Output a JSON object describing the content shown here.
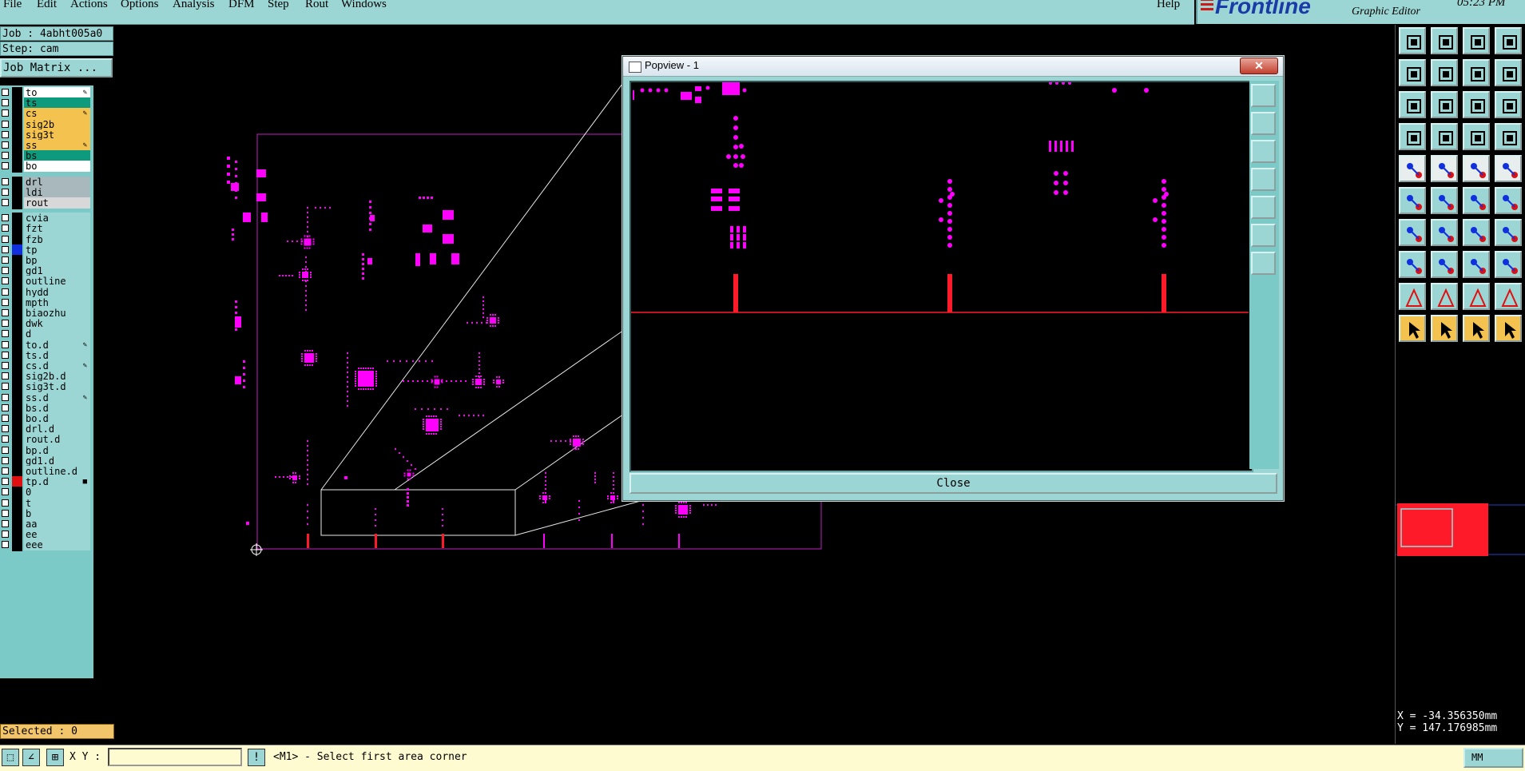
{
  "menu": {
    "items": [
      "File",
      "Edit",
      "Actions",
      "Options",
      "Analysis",
      "DFM",
      "Step",
      "Rout",
      "Windows"
    ],
    "help": "Help"
  },
  "brand": {
    "logo": "Frontline",
    "subtitle": "Graphic Editor",
    "time": "05:23 PM"
  },
  "job": {
    "job_line": "Job : 4abht005a0",
    "step_line": "Step: cam",
    "matrix_button": "Job Matrix ..."
  },
  "layers": [
    {
      "name": "to",
      "color": "#000000",
      "bg": "#ffffff",
      "mark": "pencil"
    },
    {
      "name": "ts",
      "color": "#000000",
      "bg": "#0e9a7c",
      "mark": ""
    },
    {
      "name": "cs",
      "color": "#000000",
      "bg": "#f3c24f",
      "mark": "pencil"
    },
    {
      "name": "sig2b",
      "color": "#000000",
      "bg": "#f3c24f",
      "mark": ""
    },
    {
      "name": "sig3t",
      "color": "#000000",
      "bg": "#f3c24f",
      "mark": ""
    },
    {
      "name": "ss",
      "color": "#000000",
      "bg": "#f3c24f",
      "mark": "pencil"
    },
    {
      "name": "bs",
      "color": "#000000",
      "bg": "#0e9a7c",
      "mark": ""
    },
    {
      "name": "bo",
      "color": "#000000",
      "bg": "#ffffff",
      "mark": ""
    },
    {
      "name": "drl",
      "color": "#000000",
      "bg": "#a8b8bc",
      "mark": ""
    },
    {
      "name": "ldi",
      "color": "#000000",
      "bg": "#a8b8bc",
      "mark": ""
    },
    {
      "name": "rout",
      "color": "#000000",
      "bg": "#d8d8d8",
      "mark": ""
    },
    {
      "name": "cvia",
      "color": "#000000",
      "bg": "#9cd6d4",
      "mark": ""
    },
    {
      "name": "fzt",
      "color": "#000000",
      "bg": "#9cd6d4",
      "mark": ""
    },
    {
      "name": "fzb",
      "color": "#000000",
      "bg": "#9cd6d4",
      "mark": ""
    },
    {
      "name": "tp",
      "color": "#1030e0",
      "bg": "#9cd6d4",
      "mark": ""
    },
    {
      "name": "bp",
      "color": "#000000",
      "bg": "#9cd6d4",
      "mark": ""
    },
    {
      "name": "gd1",
      "color": "#000000",
      "bg": "#9cd6d4",
      "mark": ""
    },
    {
      "name": "outline",
      "color": "#000000",
      "bg": "#9cd6d4",
      "mark": ""
    },
    {
      "name": "hydd",
      "color": "#000000",
      "bg": "#9cd6d4",
      "mark": ""
    },
    {
      "name": "mpth",
      "color": "#000000",
      "bg": "#9cd6d4",
      "mark": ""
    },
    {
      "name": "biaozhu",
      "color": "#000000",
      "bg": "#9cd6d4",
      "mark": ""
    },
    {
      "name": "dwk",
      "color": "#000000",
      "bg": "#9cd6d4",
      "mark": ""
    },
    {
      "name": "d",
      "color": "#000000",
      "bg": "#9cd6d4",
      "mark": ""
    },
    {
      "name": "to.d",
      "color": "#000000",
      "bg": "#9cd6d4",
      "mark": "pencil"
    },
    {
      "name": "ts.d",
      "color": "#000000",
      "bg": "#9cd6d4",
      "mark": ""
    },
    {
      "name": "cs.d",
      "color": "#000000",
      "bg": "#9cd6d4",
      "mark": "pencil"
    },
    {
      "name": "sig2b.d",
      "color": "#000000",
      "bg": "#9cd6d4",
      "mark": ""
    },
    {
      "name": "sig3t.d",
      "color": "#000000",
      "bg": "#9cd6d4",
      "mark": ""
    },
    {
      "name": "ss.d",
      "color": "#000000",
      "bg": "#9cd6d4",
      "mark": "pencil"
    },
    {
      "name": "bs.d",
      "color": "#000000",
      "bg": "#9cd6d4",
      "mark": ""
    },
    {
      "name": "bo.d",
      "color": "#000000",
      "bg": "#9cd6d4",
      "mark": ""
    },
    {
      "name": "drl.d",
      "color": "#000000",
      "bg": "#9cd6d4",
      "mark": ""
    },
    {
      "name": "rout.d",
      "color": "#000000",
      "bg": "#9cd6d4",
      "mark": ""
    },
    {
      "name": "bp.d",
      "color": "#000000",
      "bg": "#9cd6d4",
      "mark": ""
    },
    {
      "name": "gd1.d",
      "color": "#000000",
      "bg": "#9cd6d4",
      "mark": ""
    },
    {
      "name": "outline.d",
      "color": "#000000",
      "bg": "#9cd6d4",
      "mark": ""
    },
    {
      "name": "tp.d",
      "color": "#e01010",
      "bg": "#9cd6d4",
      "mark": "square"
    },
    {
      "name": "0",
      "color": "#000000",
      "bg": "#9cd6d4",
      "mark": ""
    },
    {
      "name": "t",
      "color": "#000000",
      "bg": "#9cd6d4",
      "mark": ""
    },
    {
      "name": "b",
      "color": "#000000",
      "bg": "#9cd6d4",
      "mark": ""
    },
    {
      "name": "aa",
      "color": "#000000",
      "bg": "#9cd6d4",
      "mark": ""
    },
    {
      "name": "ee",
      "color": "#000000",
      "bg": "#9cd6d4",
      "mark": ""
    },
    {
      "name": "eee",
      "color": "#000000",
      "bg": "#9cd6d4",
      "mark": ""
    }
  ],
  "status": {
    "selected": "Selected : 0",
    "xy_label": "X Y :",
    "xy_value": "",
    "prompt": "<M1> - Select first area corner",
    "units": "MM"
  },
  "coords": {
    "x": "X = -34.356350mm",
    "y": "Y = 147.176985mm"
  },
  "popview": {
    "title": "Popview - 1",
    "close_label": "Close"
  },
  "toolbar_icons": [
    "zoom-home-icon",
    "zoom-home-icon",
    "zoom-home-icon",
    "zoom-home-icon",
    "zoom-left-icon",
    "zoom-right-icon",
    "zoom-in-icon",
    "zoom-out-icon",
    "fit-screen-icon",
    "fit-profile-icon",
    "scale-1to2-icon",
    "help-icon",
    "pcb-layers-icon",
    "grid-icon",
    "snap-icon",
    "snap-icon",
    "feature-select-icon",
    "net-select-icon",
    "measure-icon",
    "pad-icon",
    "connect-icon",
    "intersect-icon",
    "line-icon",
    "line-icon",
    "angle-icon",
    "line-edit-icon",
    "arc-icon",
    "text-icon",
    "pad-edit-icon",
    "line-edit-icon",
    "dimension-icon",
    "cluster-icon",
    "text-a-icon",
    "text-a-icon",
    "text-a-icon",
    "text-a-icon",
    "pointer-icon",
    "pointer-icon",
    "pointer-icon",
    "pointer-icon"
  ],
  "colors": {
    "panel": "#9cd6d4",
    "feature": "#ff00ff",
    "highlight": "#ff1a2a",
    "active_layer": "#f3c24f"
  }
}
